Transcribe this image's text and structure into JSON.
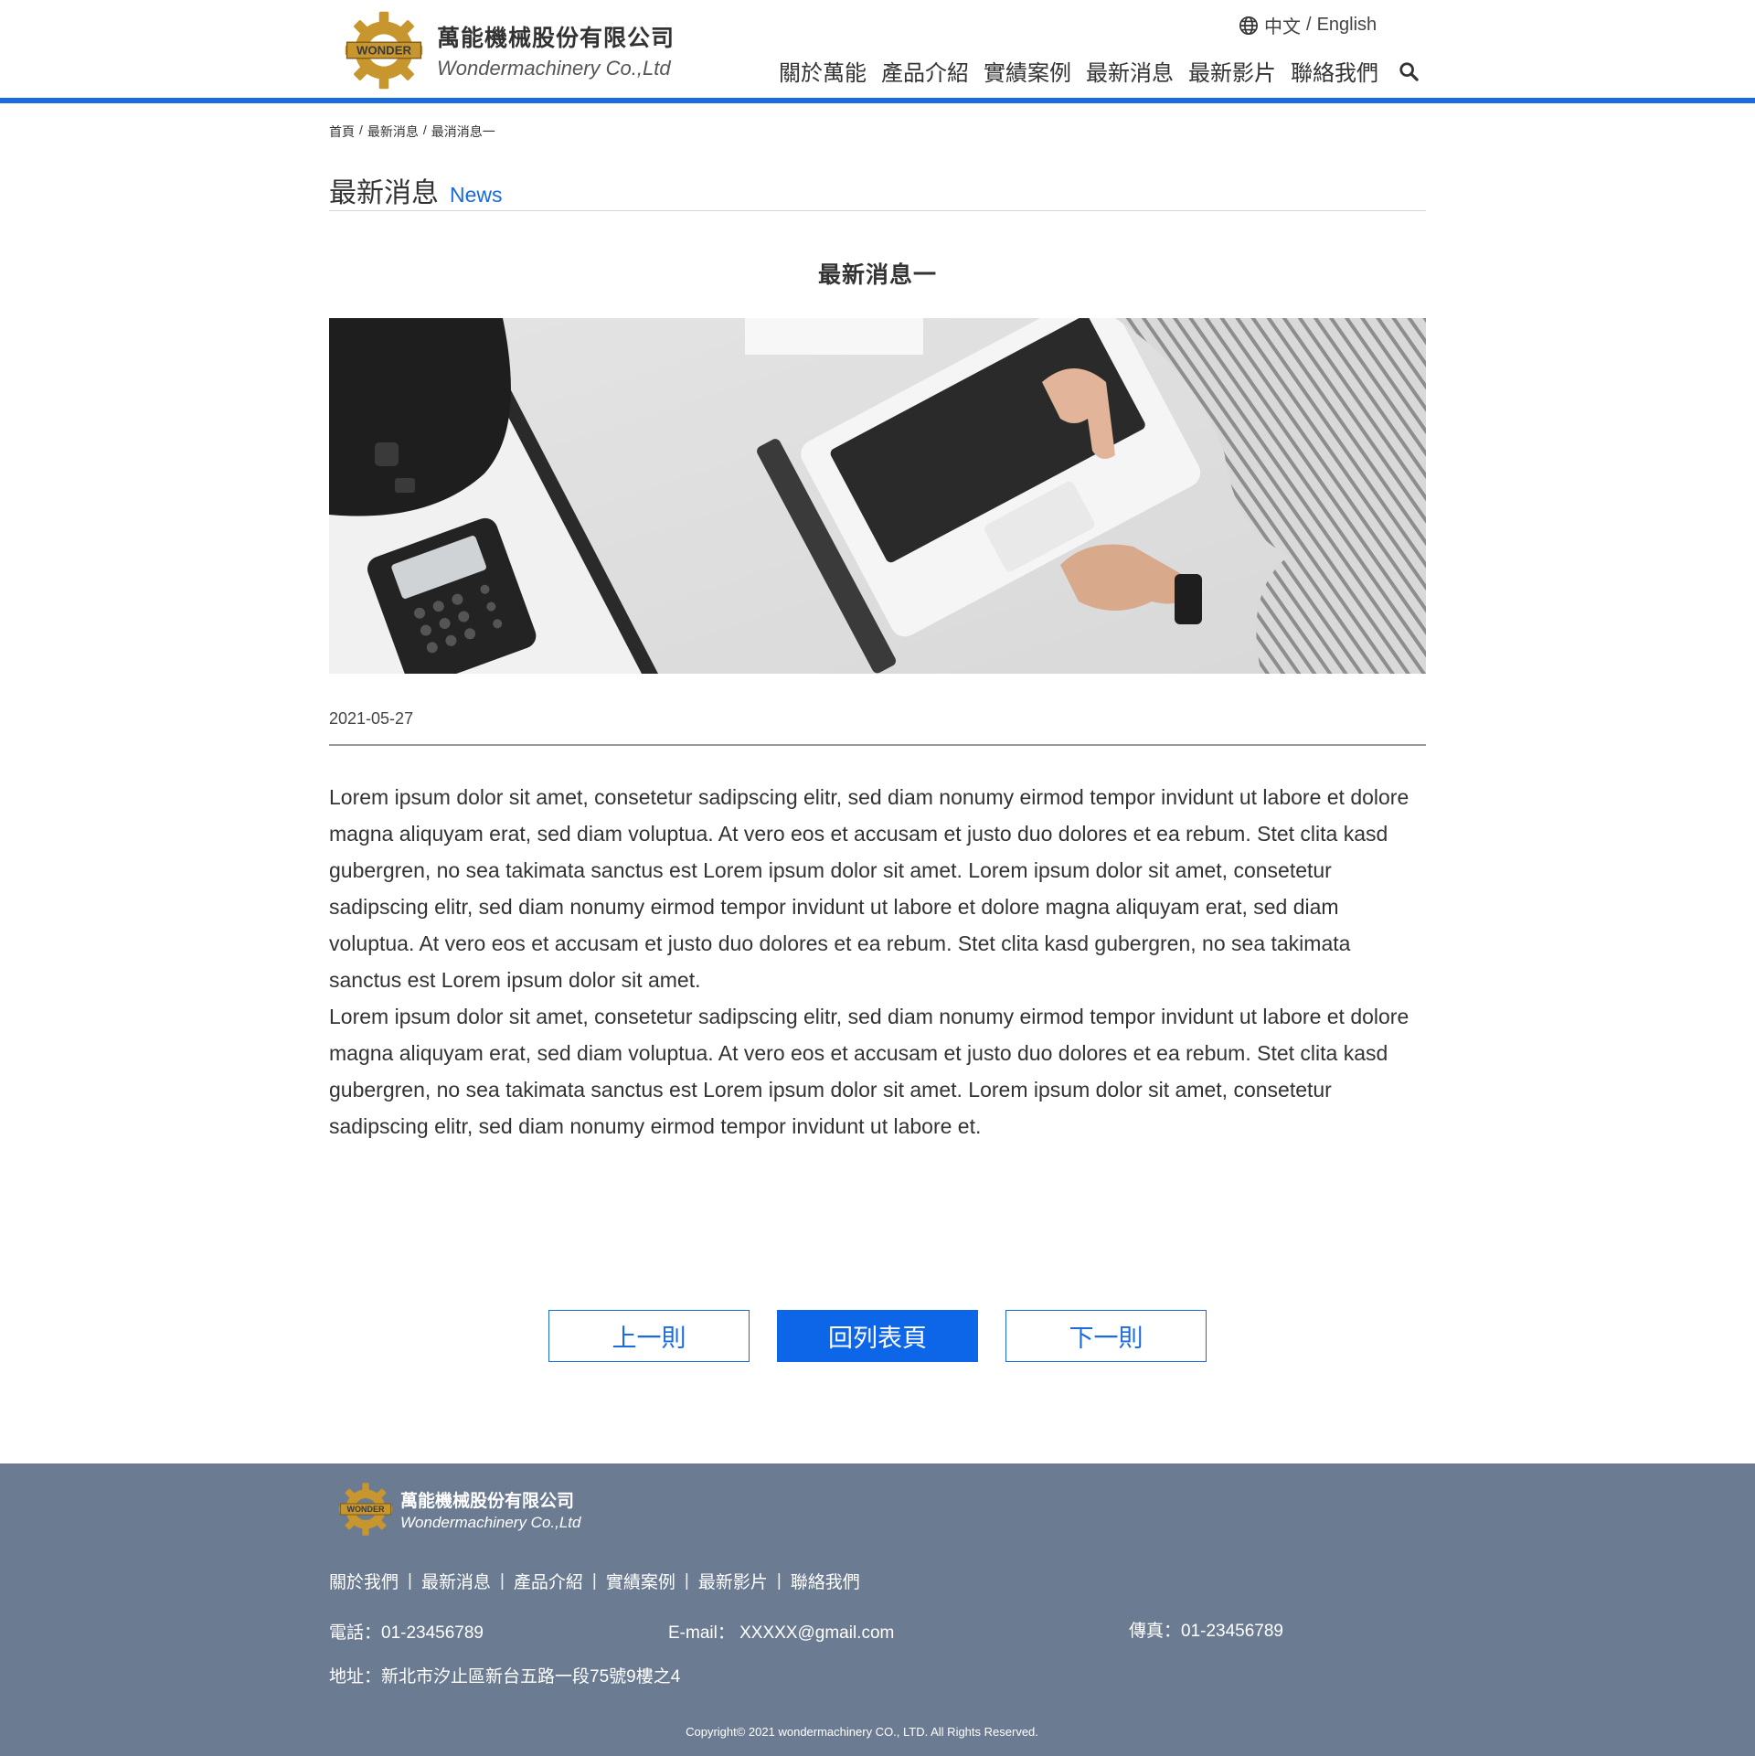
{
  "header": {
    "company_cn": "萬能機械股份有限公司",
    "company_en": "Wondermachinery Co.,Ltd",
    "logo_text": "WONDER",
    "language": {
      "zh": "中文",
      "separator": "/",
      "en": "English"
    },
    "nav": [
      "關於萬能",
      "產品介紹",
      "實績案例",
      "最新消息",
      "最新影片",
      "聯絡我們"
    ]
  },
  "breadcrumb": [
    "首頁",
    "/",
    "最新消息",
    "/",
    "最消消息一"
  ],
  "section": {
    "title_cn": "最新消息",
    "title_en": "News"
  },
  "article": {
    "title": "最新消息一",
    "date": "2021-05-27",
    "paragraphs": [
      "Lorem ipsum dolor sit amet, consetetur sadipscing elitr, sed diam nonumy eirmod tempor invidunt ut labore et dolore magna aliquyam erat, sed diam voluptua. At vero eos et accusam et justo duo dolores et ea rebum. Stet clita kasd gubergren, no sea takimata sanctus est Lorem ipsum dolor sit amet. Lorem ipsum dolor sit amet, consetetur sadipscing elitr, sed diam nonumy eirmod tempor invidunt ut labore et dolore magna aliquyam erat, sed diam voluptua. At vero eos et accusam et justo duo dolores et ea rebum. Stet clita kasd gubergren, no sea takimata sanctus est Lorem ipsum dolor sit amet.",
      "Lorem ipsum dolor sit amet, consetetur sadipscing elitr, sed diam nonumy eirmod tempor invidunt ut labore et dolore magna aliquyam erat, sed diam voluptua. At vero eos et accusam et justo duo dolores et ea rebum. Stet clita kasd gubergren, no sea takimata sanctus est Lorem ipsum dolor sit amet. Lorem ipsum dolor sit amet, consetetur sadipscing elitr, sed diam nonumy eirmod tempor invidunt ut labore et."
    ]
  },
  "pager": {
    "prev": "上一則",
    "list": "回列表頁",
    "next": "下一則"
  },
  "footer": {
    "company_cn": "萬能機械股份有限公司",
    "company_en": "Wondermachinery Co.,Ltd",
    "links": [
      "關於我們",
      "最新消息",
      "產品介紹",
      "實績案例",
      "最新影片",
      "聯絡我們"
    ],
    "link_separator": "|",
    "phone": "電話：01-23456789",
    "email": "E-mail： XXXXX@gmail.com",
    "fax": "傳真：01-23456789",
    "address": "地址：新北市汐止區新台五路一段75號9樓之4",
    "copyright": "Copyright© 2021 wondermachinery  CO., LTD. All Rights Reserved."
  },
  "colors": {
    "accent": "#1a6be0",
    "button_active": "#0d65e8",
    "footer_bg": "#6b7b92",
    "logo_gold": "#c8962e"
  },
  "icons": {
    "language": "globe-icon",
    "search": "search-icon",
    "logo": "gear-logo-icon"
  }
}
